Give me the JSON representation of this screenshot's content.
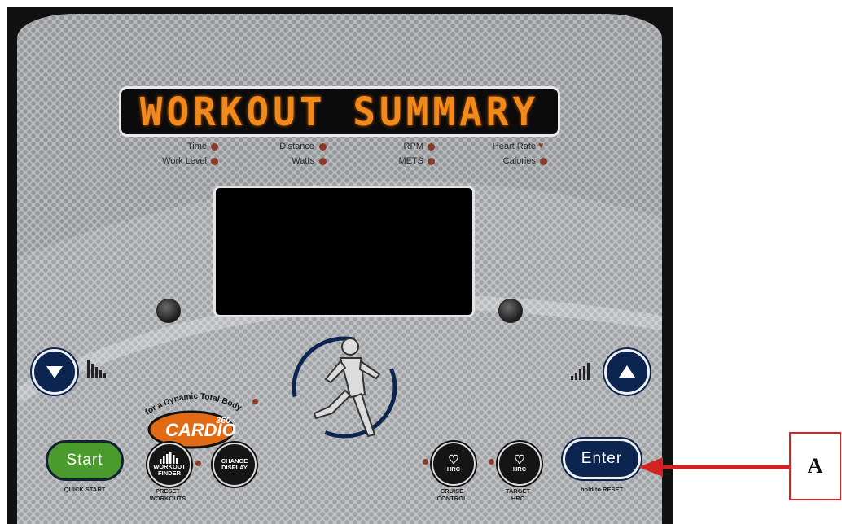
{
  "banner": {
    "text": "WORKOUT SUMMARY"
  },
  "indicators": [
    {
      "label": "Time"
    },
    {
      "label": "Distance"
    },
    {
      "label": "RPM"
    },
    {
      "label": "Heart Rate"
    },
    {
      "label": "Work Level"
    },
    {
      "label": "Watts"
    },
    {
      "label": "METS"
    },
    {
      "label": "Calories"
    }
  ],
  "brand": {
    "tagline": "for a Dynamic Total-Body Workout",
    "logo": "CARDIO",
    "logo_sup": "360"
  },
  "buttons": {
    "start": {
      "label": "Start",
      "sub": "QUICK START"
    },
    "enter": {
      "label": "Enter",
      "sub": "hold to RESET"
    },
    "workout_finder": {
      "label_1": "WORKOUT",
      "label_2": "FINDER",
      "sub_1": "PRESET",
      "sub_2": "WORKOUTS"
    },
    "change_display": {
      "label_1": "CHANGE",
      "label_2": "DISPLAY"
    },
    "cruise_control": {
      "label": "HRC",
      "sub_1": "CRUISE",
      "sub_2": "CONTROL"
    },
    "target_hrc": {
      "label": "HRC",
      "sub_1": "TARGET",
      "sub_2": "HRC"
    }
  },
  "callout": {
    "label": "A"
  },
  "colors": {
    "display_text": "#f08a1c",
    "indicator": "#8a3b28",
    "start": "#4b9a2e",
    "navy": "#0c2450",
    "callout": "#d22222"
  },
  "icons": [
    "down-arrow-icon",
    "up-arrow-icon",
    "decrease-level-icon",
    "increase-level-icon",
    "runner-icon",
    "callout-arrow-icon"
  ]
}
